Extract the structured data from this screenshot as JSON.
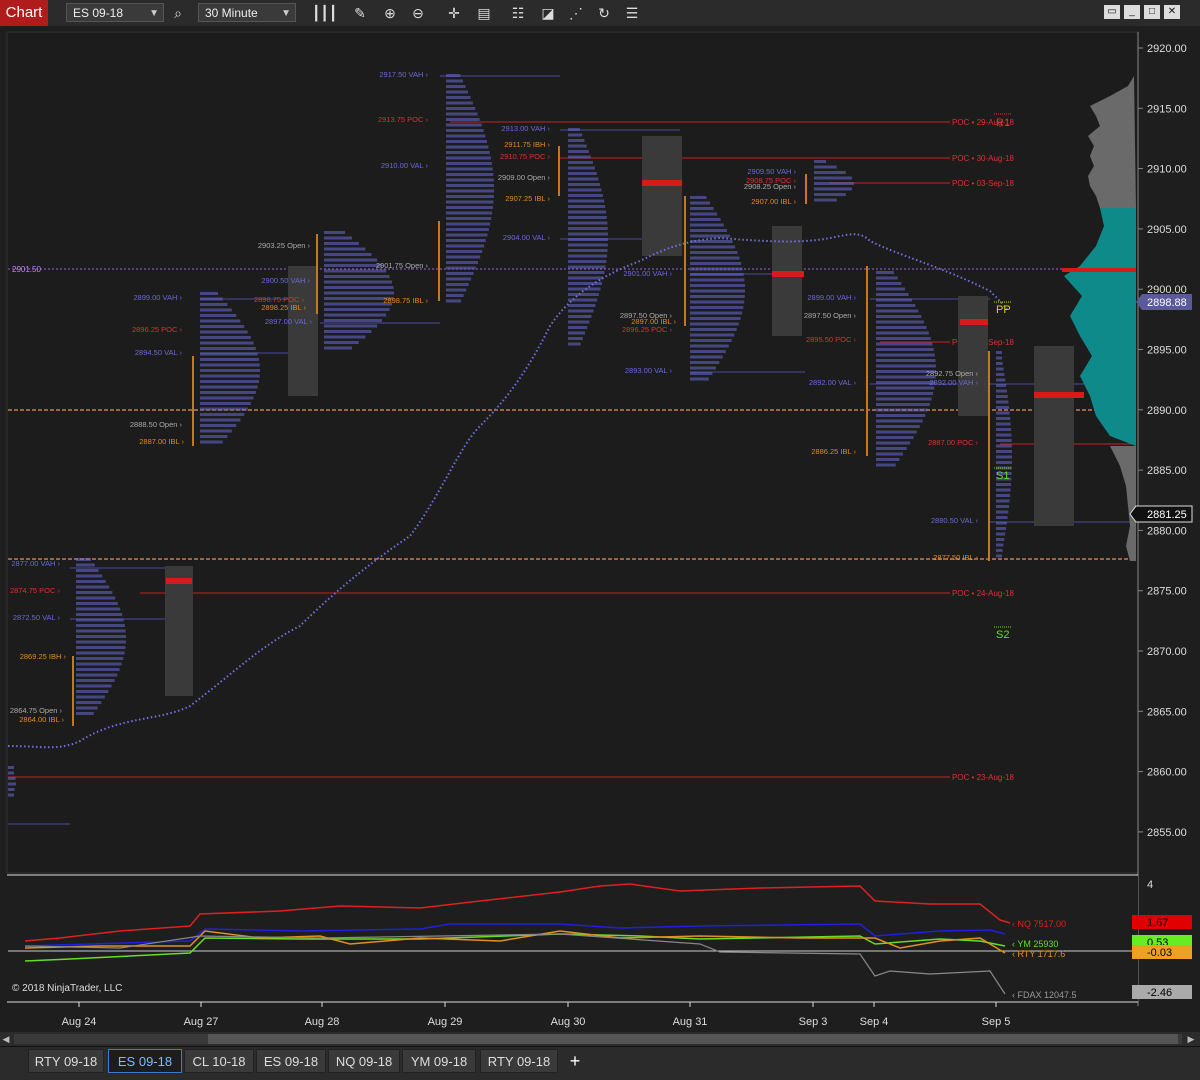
{
  "toolbar": {
    "chart_label": "Chart",
    "instrument": "ES 09-18",
    "interval": "30 Minute",
    "icons": [
      "search-icon",
      "bar-style-icon",
      "draw-icon",
      "zoom-in-icon",
      "zoom-out-icon",
      "crosshair-icon",
      "data-box-icon",
      "strategies-icon",
      "indicators-icon",
      "drawing-tools-icon",
      "reload-icon",
      "properties-icon"
    ]
  },
  "window": {
    "restore_label": "▭",
    "minimize_label": "_",
    "maximize_label": "□",
    "close_label": "✕"
  },
  "price_axis": {
    "ticks": [
      "2920.00",
      "2915.00",
      "2910.00",
      "2905.00",
      "2900.00",
      "2895.00",
      "2890.00",
      "2885.00",
      "2880.00",
      "2875.00",
      "2870.00",
      "2865.00",
      "2860.00",
      "2855.00"
    ],
    "current_price": "2881.25",
    "badge_price": "2898.88",
    "left_marker": "2901.50"
  },
  "time_axis": [
    "Aug 24",
    "Aug 27",
    "Aug 28",
    "Aug 29",
    "Aug 30",
    "Aug 31",
    "Sep 3",
    "Sep 4",
    "Sep 5"
  ],
  "pivots": {
    "r1": "R1",
    "pp": "PP",
    "s1": "S1",
    "s2": "S2"
  },
  "poc_lines": [
    {
      "label": "POC • 29-Aug-18"
    },
    {
      "label": "POC • 30-Aug-18"
    },
    {
      "label": "POC • 03-Sep-18"
    },
    {
      "label": "POC • 05-Sep-18"
    },
    {
      "label": "POC • 24-Aug-18"
    },
    {
      "label": "POC • 23-Aug-18"
    }
  ],
  "profile_labels": [
    {
      "t": "2877.00 VAH",
      "c": "#6a6ad8"
    },
    {
      "t": "2874.75 POC",
      "c": "#e03030"
    },
    {
      "t": "2872.50 VAL",
      "c": "#6a6ad8"
    },
    {
      "t": "2869.25 IBH",
      "c": "#e08a1c"
    },
    {
      "t": "2864.75 Open",
      "c": "#aaaaaa"
    },
    {
      "t": "2864.00 IBL",
      "c": "#e08a1c"
    },
    {
      "t": "2899.00 VAH",
      "c": "#6a6ad8"
    },
    {
      "t": "2896.25 POC",
      "c": "#e03030"
    },
    {
      "t": "2894.50 VAL",
      "c": "#6a6ad8"
    },
    {
      "t": "2888.50 Open",
      "c": "#aaaaaa"
    },
    {
      "t": "2887.00 IBL",
      "c": "#e08a1c"
    },
    {
      "t": "2903.25 Open",
      "c": "#aaaaaa"
    },
    {
      "t": "2900.50 VAH",
      "c": "#6a6ad8"
    },
    {
      "t": "2898.75 POC",
      "c": "#e03030"
    },
    {
      "t": "2898.25 IBL",
      "c": "#e08a1c"
    },
    {
      "t": "2897.00 VAL",
      "c": "#6a6ad8"
    },
    {
      "t": "2917.50 VAH",
      "c": "#6a6ad8"
    },
    {
      "t": "2913.75 POC",
      "c": "#e03030"
    },
    {
      "t": "2910.00 VAL",
      "c": "#6a6ad8"
    },
    {
      "t": "2901.75 Open",
      "c": "#aaaaaa"
    },
    {
      "t": "2898.75 IBL",
      "c": "#e08a1c"
    },
    {
      "t": "2913.00 VAH",
      "c": "#6a6ad8"
    },
    {
      "t": "2911.75 IBH",
      "c": "#e08a1c"
    },
    {
      "t": "2910.75 POC",
      "c": "#e03030"
    },
    {
      "t": "2909.00 Open",
      "c": "#aaaaaa"
    },
    {
      "t": "2907.25 IBL",
      "c": "#e08a1c"
    },
    {
      "t": "2904.00 VAL",
      "c": "#6a6ad8"
    },
    {
      "t": "2901.00 VAH",
      "c": "#6a6ad8"
    },
    {
      "t": "2897.50 Open",
      "c": "#aaaaaa"
    },
    {
      "t": "2897.00 IBL",
      "c": "#e08a1c"
    },
    {
      "t": "2896.25 POC",
      "c": "#e03030"
    },
    {
      "t": "2893.00 VAL",
      "c": "#6a6ad8"
    },
    {
      "t": "2909.50 VAH",
      "c": "#6a6ad8"
    },
    {
      "t": "2908.75 POC",
      "c": "#e03030"
    },
    {
      "t": "2908.25 Open",
      "c": "#aaaaaa"
    },
    {
      "t": "2907.00 IBL",
      "c": "#e08a1c"
    },
    {
      "t": "2899.00 VAH",
      "c": "#6a6ad8"
    },
    {
      "t": "2897.50 Open",
      "c": "#aaaaaa"
    },
    {
      "t": "2895.50 POC",
      "c": "#e03030"
    },
    {
      "t": "2892.00 VAL",
      "c": "#6a6ad8"
    },
    {
      "t": "2886.25 IBL",
      "c": "#e08a1c"
    },
    {
      "t": "2892.75 Open",
      "c": "#aaaaaa"
    },
    {
      "t": "2892.00 VAH",
      "c": "#6a6ad8"
    },
    {
      "t": "2887.00 POC",
      "c": "#e03030"
    },
    {
      "t": "2880.50 VAL",
      "c": "#6a6ad8"
    },
    {
      "t": "2877.50 IBL",
      "c": "#e08a1c"
    }
  ],
  "lower_panel": {
    "axis_top": "4",
    "legend": [
      {
        "label": "NQ 7517.00",
        "color": "#e02020"
      },
      {
        "label": "YM 25930",
        "color": "#66dd22"
      },
      {
        "label": "RTY 1717.6",
        "color": "#e09020"
      },
      {
        "label": "FDAX 12047.5",
        "color": "#999999"
      }
    ],
    "badges": [
      {
        "value": "1.67",
        "color": "#e00000"
      },
      {
        "value": "0.53",
        "color": "#66ee22"
      },
      {
        "value": "-0.03",
        "color": "#f0a020"
      },
      {
        "value": "-2.46",
        "color": "#aaaaaa"
      }
    ]
  },
  "copyright": "© 2018 NinjaTrader, LLC",
  "tabs": [
    "RTY 09-18",
    "ES 09-18",
    "CL 10-18",
    "ES 09-18",
    "NQ 09-18",
    "YM 09-18",
    "RTY 09-18"
  ],
  "active_tab": 1,
  "add_tab_label": "+"
}
